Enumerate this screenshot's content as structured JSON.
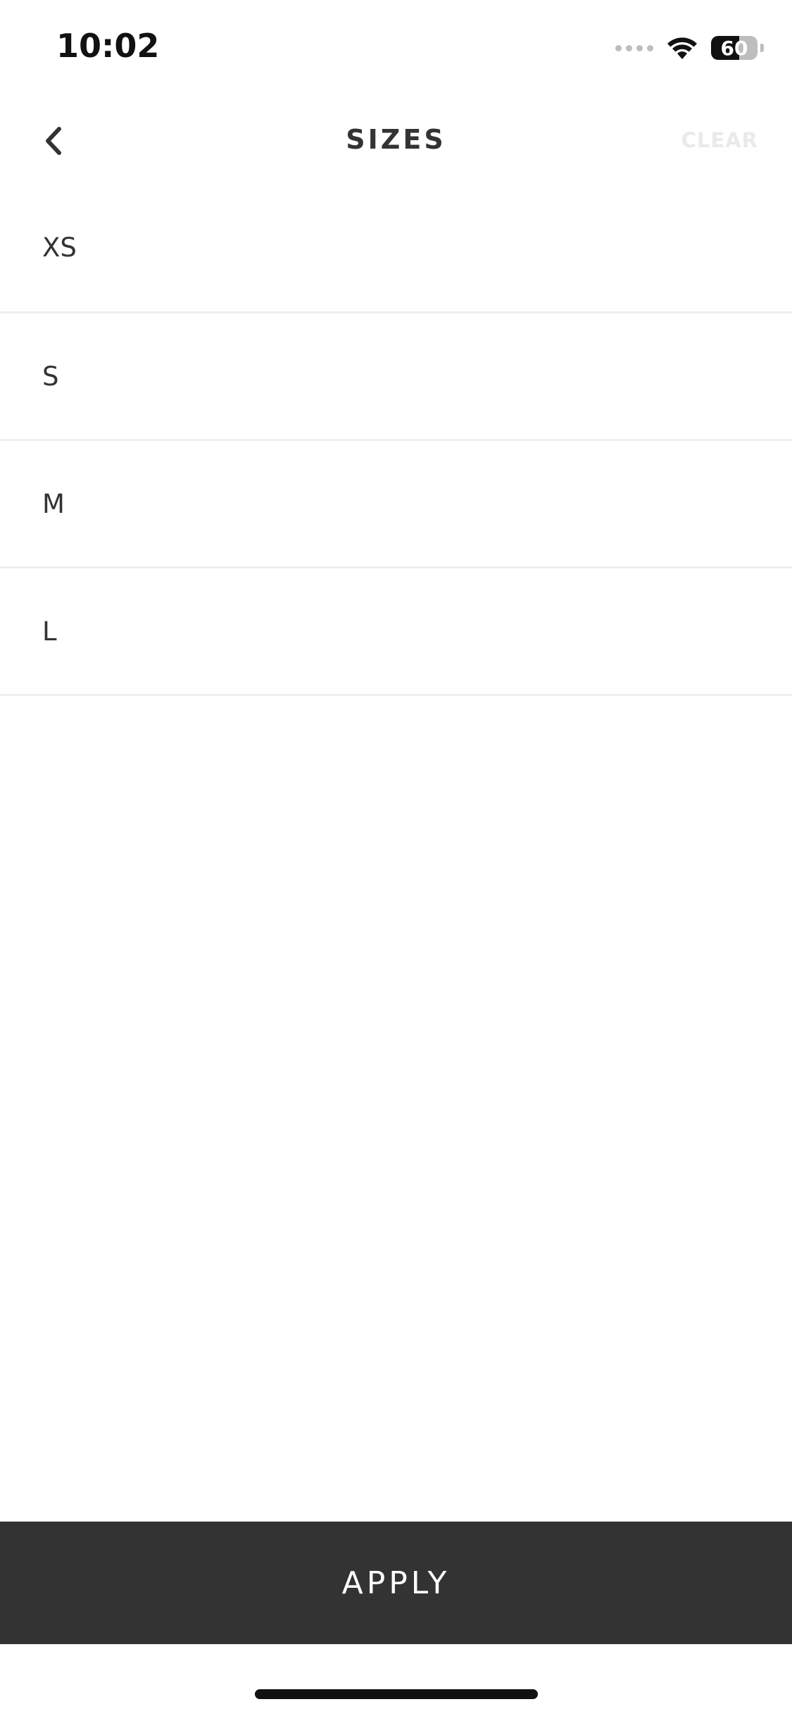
{
  "status_bar": {
    "time": "10:02",
    "battery_percent": "60",
    "battery_level": 0.6,
    "icons": [
      "cellular-signal-icon",
      "wifi-icon",
      "battery-icon"
    ]
  },
  "header": {
    "title": "SIZES",
    "clear_label": "CLEAR",
    "back_icon": "chevron-left-icon"
  },
  "sizes": [
    {
      "label": "XS"
    },
    {
      "label": "S"
    },
    {
      "label": "M"
    },
    {
      "label": "L"
    }
  ],
  "footer": {
    "apply_label": "APPLY"
  },
  "colors": {
    "text": "#333333",
    "apply_background": "#333333",
    "apply_text": "#ffffff",
    "clear_disabled": "#eaeaea",
    "divider": "#eeeeee",
    "background": "#ffffff"
  }
}
